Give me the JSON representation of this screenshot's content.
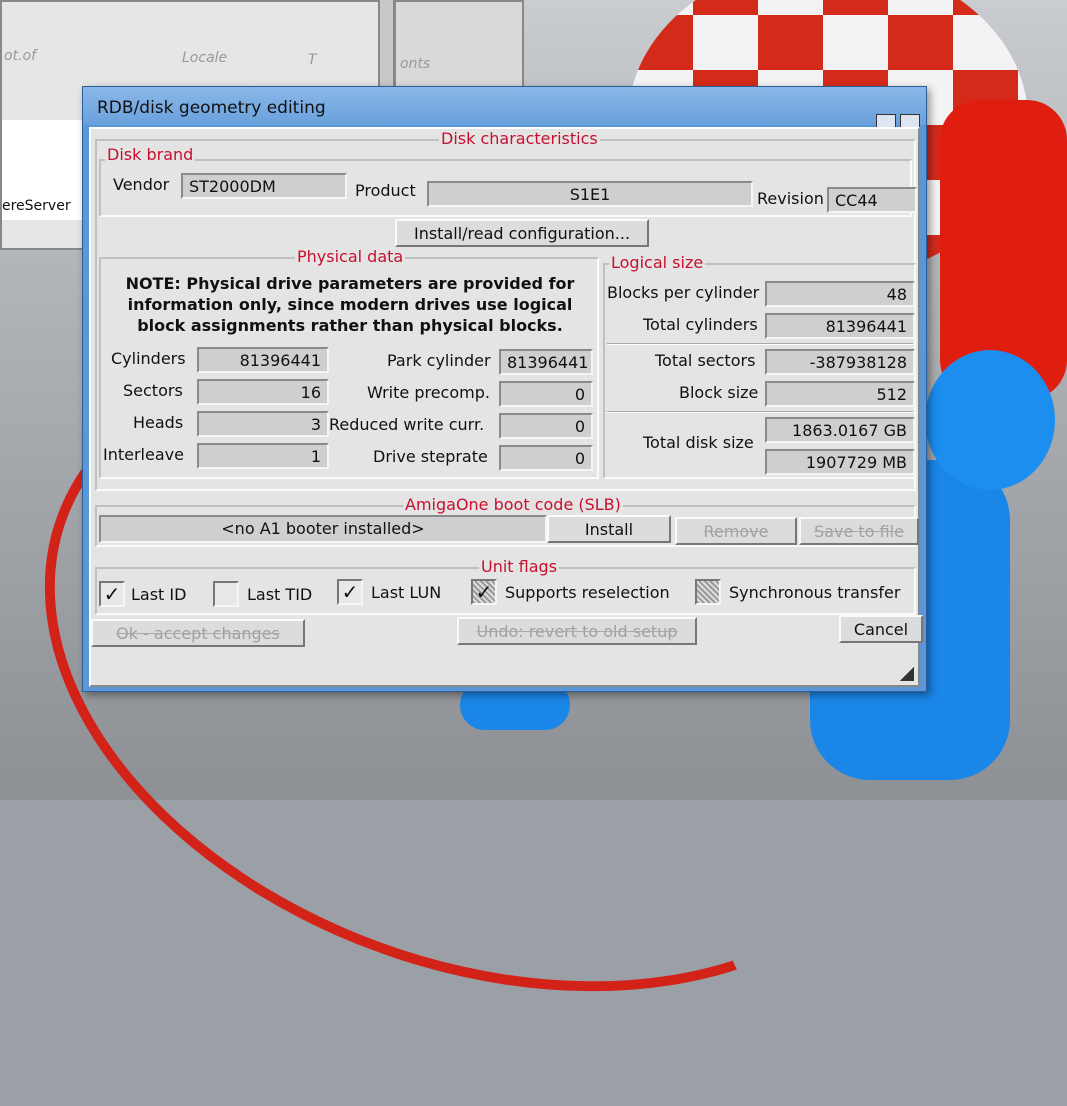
{
  "desktop": {
    "icon_labels": [
      "ot.of",
      "Locale",
      "T",
      "onts",
      "ereServer"
    ]
  },
  "window": {
    "title": "RDB/disk geometry editing",
    "disk_characteristics": {
      "title": "Disk characteristics",
      "disk_brand": {
        "title": "Disk brand",
        "vendor_label": "Vendor",
        "vendor_value": "ST2000DM",
        "product_label": "Product",
        "product_value": "S1E1",
        "revision_label": "Revision",
        "revision_value": "CC44"
      },
      "install_button": "Install/read configuration..."
    },
    "physical_data": {
      "title": "Physical data",
      "note": "NOTE: Physical drive parameters are provided for information only, since modern drives use logical block assignments rather than physical blocks.",
      "fields": {
        "cylinders_label": "Cylinders",
        "cylinders_value": "81396441",
        "sectors_label": "Sectors",
        "sectors_value": "16",
        "heads_label": "Heads",
        "heads_value": "3",
        "interleave_label": "Interleave",
        "interleave_value": "1",
        "park_label": "Park cylinder",
        "park_value": "81396441",
        "precomp_label": "Write precomp.",
        "precomp_value": "0",
        "reduced_label": "Reduced write curr.",
        "reduced_value": "0",
        "steprate_label": "Drive steprate",
        "steprate_value": "0"
      }
    },
    "logical_size": {
      "title": "Logical size",
      "blocks_per_cyl_label": "Blocks per cylinder",
      "blocks_per_cyl_value": "48",
      "total_cyl_label": "Total cylinders",
      "total_cyl_value": "81396441",
      "total_sectors_label": "Total sectors",
      "total_sectors_value": "-387938128",
      "block_size_label": "Block size",
      "block_size_value": "512",
      "disk_size_label": "Total disk size",
      "disk_size_gb": "1863.0167 GB",
      "disk_size_mb": "1907729 MB"
    },
    "boot_code": {
      "title": "AmigaOne boot code (SLB)",
      "status": "<no A1 booter installed>",
      "install": "Install",
      "remove": "Remove",
      "save": "Save to file"
    },
    "unit_flags": {
      "title": "Unit flags",
      "last_id": "Last ID",
      "last_tid": "Last TID",
      "last_lun": "Last LUN",
      "reselection": "Supports reselection",
      "sync": "Synchronous transfer"
    },
    "footer": {
      "ok": "Ok - accept changes",
      "undo": "Undo: revert to old setup",
      "cancel": "Cancel"
    }
  }
}
